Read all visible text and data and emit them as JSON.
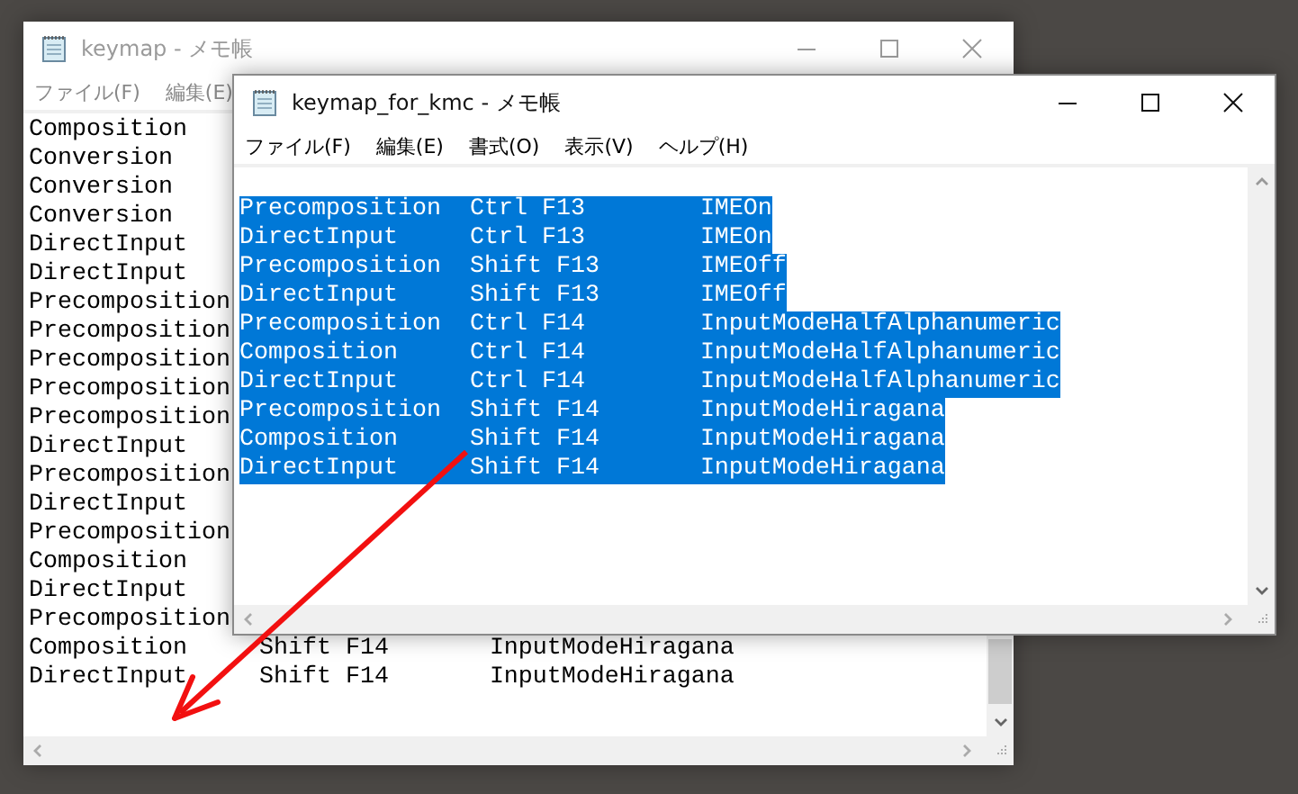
{
  "back_window": {
    "title": "keymap - メモ帳",
    "active": false,
    "menu": [
      "ファイル(F)",
      "編集(E)"
    ],
    "lines": [
      {
        "cols": [
          "Composition"
        ],
        "selected": false
      },
      {
        "cols": [
          "Conversion"
        ],
        "selected": false
      },
      {
        "cols": [
          "Conversion"
        ],
        "selected": false
      },
      {
        "cols": [
          "Conversion"
        ],
        "selected": false
      },
      {
        "cols": [
          "DirectInput"
        ],
        "selected": false
      },
      {
        "cols": [
          "DirectInput"
        ],
        "selected": false
      },
      {
        "cols": [
          "Precomposition"
        ],
        "selected": false
      },
      {
        "cols": [
          "Precomposition"
        ],
        "selected": false
      },
      {
        "cols": [
          "Precomposition"
        ],
        "selected": false
      },
      {
        "cols": [
          "Precomposition"
        ],
        "selected": false
      },
      {
        "cols": [
          "Precomposition"
        ],
        "selected": false
      },
      {
        "cols": [
          "DirectInput"
        ],
        "selected": false
      },
      {
        "cols": [
          "Precomposition"
        ],
        "selected": false
      },
      {
        "cols": [
          "DirectInput"
        ],
        "selected": false
      },
      {
        "cols": [
          "Precomposition"
        ],
        "selected": false
      },
      {
        "cols": [
          "Composition"
        ],
        "selected": false
      },
      {
        "cols": [
          "DirectInput"
        ],
        "selected": false
      },
      {
        "cols": [
          "Precomposition"
        ],
        "selected": false
      },
      {
        "cols": [
          "Composition",
          "Shift F14",
          "InputModeHiragana"
        ],
        "selected": false
      },
      {
        "cols": [
          "DirectInput",
          "Shift F14",
          "InputModeHiragana"
        ],
        "selected": false
      }
    ]
  },
  "front_window": {
    "title": "keymap_for_kmc - メモ帳",
    "active": true,
    "menu": [
      "ファイル(F)",
      "編集(E)",
      "書式(O)",
      "表示(V)",
      "ヘルプ(H)"
    ],
    "lines": [
      {
        "cols": [
          "Precomposition",
          "Ctrl F13",
          "IMEOn"
        ],
        "selected": true
      },
      {
        "cols": [
          "DirectInput",
          "Ctrl F13",
          "IMEOn"
        ],
        "selected": true
      },
      {
        "cols": [
          "Precomposition",
          "Shift F13",
          "IMEOff"
        ],
        "selected": true
      },
      {
        "cols": [
          "DirectInput",
          "Shift F13",
          "IMEOff"
        ],
        "selected": true
      },
      {
        "cols": [
          "Precomposition",
          "Ctrl F14",
          "InputModeHalfAlphanumeric"
        ],
        "selected": true
      },
      {
        "cols": [
          "Composition",
          "Ctrl F14",
          "InputModeHalfAlphanumeric"
        ],
        "selected": true
      },
      {
        "cols": [
          "DirectInput",
          "Ctrl F14",
          "InputModeHalfAlphanumeric"
        ],
        "selected": true
      },
      {
        "cols": [
          "Precomposition",
          "Shift F14",
          "InputModeHiragana"
        ],
        "selected": true
      },
      {
        "cols": [
          "Composition",
          "Shift F14",
          "InputModeHiragana"
        ],
        "selected": true
      },
      {
        "cols": [
          "DirectInput",
          "Shift F14",
          "InputModeHiragana"
        ],
        "selected": true
      }
    ]
  }
}
